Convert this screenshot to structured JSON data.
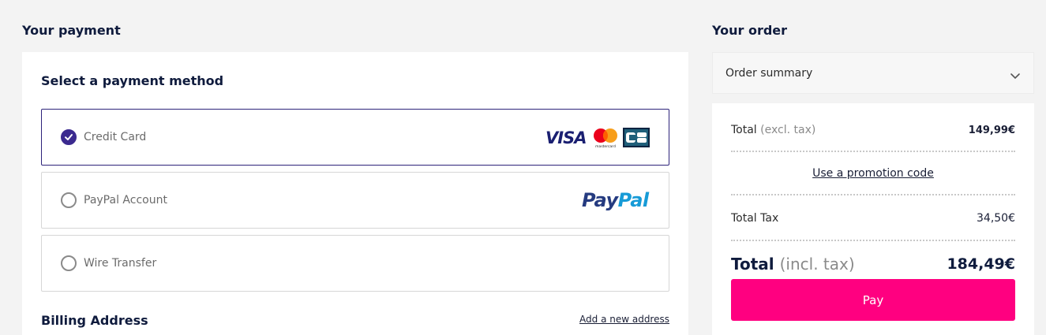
{
  "payment": {
    "title": "Your payment",
    "method_heading": "Select a payment method",
    "options": [
      {
        "label": "Credit Card",
        "selected": true,
        "brands": [
          "visa-logo",
          "mastercard-logo",
          "cb-logo"
        ]
      },
      {
        "label": "PayPal Account",
        "selected": false,
        "brands": [
          "paypal-logo"
        ]
      },
      {
        "label": "Wire Transfer",
        "selected": false,
        "brands": []
      }
    ],
    "brand_text": {
      "visa": "VISA",
      "mastercard": "mastercard",
      "paypal_part1": "Pay",
      "paypal_part2": "Pal"
    },
    "billing_heading": "Billing Address",
    "add_address_link": "Add a new address"
  },
  "order": {
    "title": "Your order",
    "summary_label": "Order summary",
    "total_excl_label": "Total",
    "total_excl_note": "(excl. tax)",
    "total_excl_value": "149,99€",
    "promo_link": "Use a promotion code",
    "tax_label": "Total Tax",
    "tax_value": "34,50€",
    "total_label": "Total",
    "total_note": "(incl. tax)",
    "total_value": "184,49€",
    "pay_button": "Pay"
  },
  "colors": {
    "accent": "#ff0080",
    "selected": "#3b2a8f",
    "heading": "#0f1b3d"
  }
}
